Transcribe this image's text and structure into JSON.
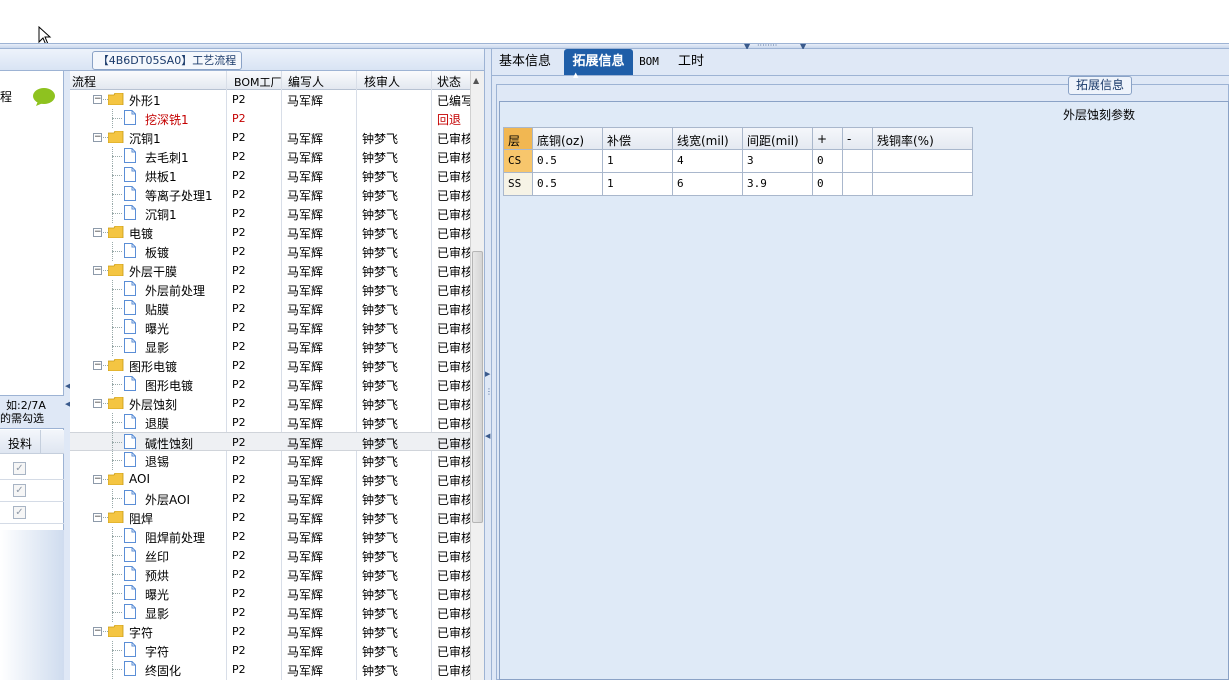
{
  "left_panel": {
    "tab_title": "【4B6DT05SA0】工艺流程",
    "partial_text_top": "程",
    "strip_text_line1": "如:2/7A",
    "strip_text_line2": "的需勾选",
    "column_tou_liao": "投料",
    "checked_rows": 3
  },
  "grid": {
    "headers": {
      "flow": "流程",
      "bom": "BOM工厂",
      "writer": "编写人",
      "reviewer": "核审人",
      "status": "状态"
    },
    "rows": [
      {
        "level": 0,
        "name": "外形1",
        "bom": "P2",
        "writer": "马军辉",
        "reviewer": "",
        "status": "已编写",
        "red": false
      },
      {
        "level": 1,
        "name": "挖深铣1",
        "bom": "P2",
        "writer": "",
        "reviewer": "",
        "status": "回退",
        "red": true
      },
      {
        "level": 0,
        "name": "沉铜1",
        "bom": "P2",
        "writer": "马军辉",
        "reviewer": "钟梦飞",
        "status": "已审核",
        "red": false
      },
      {
        "level": 1,
        "name": "去毛刺1",
        "bom": "P2",
        "writer": "马军辉",
        "reviewer": "钟梦飞",
        "status": "已审核",
        "red": false
      },
      {
        "level": 1,
        "name": "烘板1",
        "bom": "P2",
        "writer": "马军辉",
        "reviewer": "钟梦飞",
        "status": "已审核",
        "red": false
      },
      {
        "level": 1,
        "name": "等离子处理1",
        "bom": "P2",
        "writer": "马军辉",
        "reviewer": "钟梦飞",
        "status": "已审核",
        "red": false
      },
      {
        "level": 1,
        "name": "沉铜1",
        "bom": "P2",
        "writer": "马军辉",
        "reviewer": "钟梦飞",
        "status": "已审核",
        "red": false
      },
      {
        "level": 0,
        "name": "电镀",
        "bom": "P2",
        "writer": "马军辉",
        "reviewer": "钟梦飞",
        "status": "已审核",
        "red": false
      },
      {
        "level": 1,
        "name": "板镀",
        "bom": "P2",
        "writer": "马军辉",
        "reviewer": "钟梦飞",
        "status": "已审核",
        "red": false
      },
      {
        "level": 0,
        "name": "外层干膜",
        "bom": "P2",
        "writer": "马军辉",
        "reviewer": "钟梦飞",
        "status": "已审核",
        "red": false
      },
      {
        "level": 1,
        "name": "外层前处理",
        "bom": "P2",
        "writer": "马军辉",
        "reviewer": "钟梦飞",
        "status": "已审核",
        "red": false
      },
      {
        "level": 1,
        "name": "贴膜",
        "bom": "P2",
        "writer": "马军辉",
        "reviewer": "钟梦飞",
        "status": "已审核",
        "red": false
      },
      {
        "level": 1,
        "name": "曝光",
        "bom": "P2",
        "writer": "马军辉",
        "reviewer": "钟梦飞",
        "status": "已审核",
        "red": false
      },
      {
        "level": 1,
        "name": "显影",
        "bom": "P2",
        "writer": "马军辉",
        "reviewer": "钟梦飞",
        "status": "已审核",
        "red": false
      },
      {
        "level": 0,
        "name": "图形电镀",
        "bom": "P2",
        "writer": "马军辉",
        "reviewer": "钟梦飞",
        "status": "已审核",
        "red": false
      },
      {
        "level": 1,
        "name": "图形电镀",
        "bom": "P2",
        "writer": "马军辉",
        "reviewer": "钟梦飞",
        "status": "已审核",
        "red": false
      },
      {
        "level": 0,
        "name": "外层蚀刻",
        "bom": "P2",
        "writer": "马军辉",
        "reviewer": "钟梦飞",
        "status": "已审核",
        "red": false
      },
      {
        "level": 1,
        "name": "退膜",
        "bom": "P2",
        "writer": "马军辉",
        "reviewer": "钟梦飞",
        "status": "已审核",
        "red": false
      },
      {
        "level": 1,
        "name": "碱性蚀刻",
        "bom": "P2",
        "writer": "马军辉",
        "reviewer": "钟梦飞",
        "status": "已审核",
        "red": false,
        "selected": true
      },
      {
        "level": 1,
        "name": "退锡",
        "bom": "P2",
        "writer": "马军辉",
        "reviewer": "钟梦飞",
        "status": "已审核",
        "red": false
      },
      {
        "level": 0,
        "name": "AOI",
        "bom": "P2",
        "writer": "马军辉",
        "reviewer": "钟梦飞",
        "status": "已审核",
        "red": false
      },
      {
        "level": 1,
        "name": "外层AOI",
        "bom": "P2",
        "writer": "马军辉",
        "reviewer": "钟梦飞",
        "status": "已审核",
        "red": false
      },
      {
        "level": 0,
        "name": "阻焊",
        "bom": "P2",
        "writer": "马军辉",
        "reviewer": "钟梦飞",
        "status": "已审核",
        "red": false
      },
      {
        "level": 1,
        "name": "阻焊前处理",
        "bom": "P2",
        "writer": "马军辉",
        "reviewer": "钟梦飞",
        "status": "已审核",
        "red": false
      },
      {
        "level": 1,
        "name": "丝印",
        "bom": "P2",
        "writer": "马军辉",
        "reviewer": "钟梦飞",
        "status": "已审核",
        "red": false
      },
      {
        "level": 1,
        "name": "预烘",
        "bom": "P2",
        "writer": "马军辉",
        "reviewer": "钟梦飞",
        "status": "已审核",
        "red": false
      },
      {
        "level": 1,
        "name": "曝光",
        "bom": "P2",
        "writer": "马军辉",
        "reviewer": "钟梦飞",
        "status": "已审核",
        "red": false
      },
      {
        "level": 1,
        "name": "显影",
        "bom": "P2",
        "writer": "马军辉",
        "reviewer": "钟梦飞",
        "status": "已审核",
        "red": false
      },
      {
        "level": 0,
        "name": "字符",
        "bom": "P2",
        "writer": "马军辉",
        "reviewer": "钟梦飞",
        "status": "已审核",
        "red": false
      },
      {
        "level": 1,
        "name": "字符",
        "bom": "P2",
        "writer": "马军辉",
        "reviewer": "钟梦飞",
        "status": "已审核",
        "red": false
      },
      {
        "level": 1,
        "name": "终固化",
        "bom": "P2",
        "writer": "马军辉",
        "reviewer": "钟梦飞",
        "status": "已审核",
        "red": false
      }
    ]
  },
  "right_panel": {
    "tabs": [
      {
        "label": "基本信息",
        "active": false
      },
      {
        "label": "拓展信息",
        "active": true
      },
      {
        "label": "BOM",
        "active": false
      },
      {
        "label": "工时",
        "active": false
      }
    ],
    "group_legend": "拓展信息",
    "param_title": "外层蚀刻参数",
    "table": {
      "headers": [
        "层",
        "底铜(oz)",
        "补偿",
        "线宽(mil)",
        "间距(mil)",
        "+",
        "-",
        "残铜率(%)"
      ],
      "rows": [
        [
          "CS",
          "0.5",
          "1",
          "4",
          "3",
          "0",
          "",
          ""
        ],
        [
          "SS",
          "0.5",
          "1",
          "6",
          "3.9",
          "0",
          "",
          ""
        ]
      ]
    }
  },
  "colors": {
    "accent": "#1f5ea8",
    "panel_bg": "#dfe8f6",
    "reject_red": "#c40000",
    "layer_highlight": "#f7c66c"
  }
}
